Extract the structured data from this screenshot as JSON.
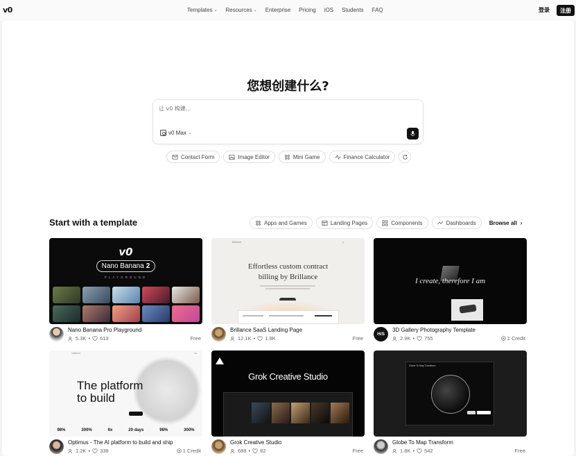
{
  "nav": {
    "logo": "v0",
    "links": [
      {
        "label": "Templates",
        "dropdown": true
      },
      {
        "label": "Resources",
        "dropdown": true
      },
      {
        "label": "Enterprise",
        "dropdown": false
      },
      {
        "label": "Pricing",
        "dropdown": false
      },
      {
        "label": "iOS",
        "dropdown": false
      },
      {
        "label": "Students",
        "dropdown": false
      },
      {
        "label": "FAQ",
        "dropdown": false
      }
    ],
    "login": "登录",
    "signup": "注册"
  },
  "hero": {
    "title": "您想创建什么?",
    "placeholder": "让 v0 构建...",
    "model": "v0 Max",
    "suggestions": [
      {
        "label": "Contact Form",
        "icon": "mail-icon"
      },
      {
        "label": "Image Editor",
        "icon": "image-icon"
      },
      {
        "label": "Mini Game",
        "icon": "gamepad-icon"
      },
      {
        "label": "Finance Calculator",
        "icon": "activity-icon"
      }
    ]
  },
  "templates": {
    "title": "Start with a template",
    "categories": [
      {
        "label": "Apps and Games",
        "icon": "apps-icon"
      },
      {
        "label": "Landing Pages",
        "icon": "layout-icon"
      },
      {
        "label": "Components",
        "icon": "grid-icon"
      },
      {
        "label": "Dashboards",
        "icon": "chart-line-icon"
      }
    ],
    "browse_all": "Browse all",
    "cards": [
      {
        "title": "Nano Banana Pro Playground",
        "users": "5.3K",
        "likes": "613",
        "price": "Free",
        "credit": false,
        "thumb": {
          "brand": "v0",
          "badge": "Nano Banana",
          "badge_num": "2",
          "subtitle": "PLAYGROUND"
        }
      },
      {
        "title": "Brillance SaaS Landing Page",
        "users": "12.1K",
        "likes": "1.8K",
        "price": "Free",
        "credit": false,
        "thumb": {
          "headline_1": "Effortless custom contract",
          "headline_2": "billing by Brillance",
          "brand": "Brillance"
        }
      },
      {
        "title": "3D Gallery Photography Template",
        "users": "2.9K",
        "likes": "755",
        "price": "1 Credit",
        "credit": true,
        "avatar_text": "H/S",
        "thumb": {
          "headline": "I create, therefore I am"
        }
      },
      {
        "title": "Optimus - The AI platform to build and ship",
        "users": "1.2K",
        "likes": "338",
        "price": "1 Credit",
        "credit": true,
        "thumb": {
          "headline_1": "The platform",
          "headline_2": "to build",
          "brand": "Optimus",
          "stats": [
            "98%",
            "300%",
            "6x",
            "20 days",
            "98%",
            "300%"
          ]
        }
      },
      {
        "title": "Grok Creative Studio",
        "users": "688",
        "likes": "82",
        "price": "Free",
        "credit": false,
        "thumb": {
          "headline": "Grok Creative Studio"
        }
      },
      {
        "title": "Globe To Map Transform",
        "users": "1.8K",
        "likes": "542",
        "price": "Free",
        "credit": false,
        "thumb": {
          "title": "Globe To Map Transform"
        }
      }
    ]
  },
  "colors": {
    "accent": "#111111",
    "background": "#f3f3f3",
    "panel": "#ffffff",
    "muted": "#666666"
  }
}
